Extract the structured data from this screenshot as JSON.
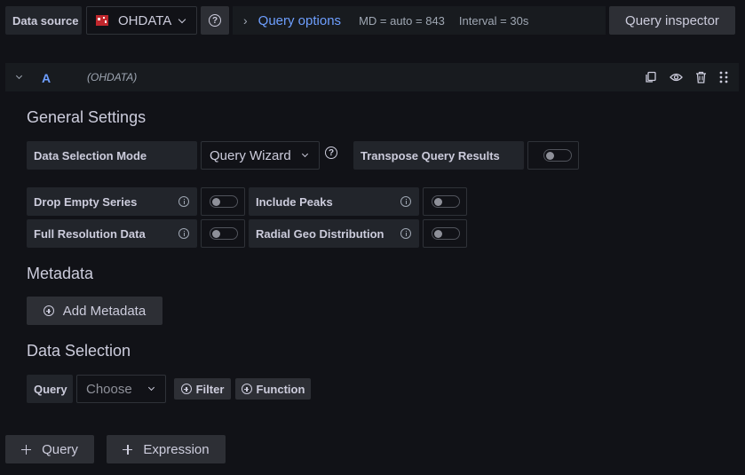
{
  "toolbar": {
    "data_source_label": "Data source",
    "datasource_name": "OHDATA",
    "query_options_label": "Query options",
    "md_info": "MD = auto = 843",
    "interval_info": "Interval = 30s",
    "query_inspector_label": "Query inspector"
  },
  "query_row": {
    "ref_id": "A",
    "datasource_tag": "(OHDATA)"
  },
  "general_settings": {
    "heading": "General Settings",
    "data_selection_mode_label": "Data Selection Mode",
    "data_selection_mode_value": "Query Wizard",
    "transpose_label": "Transpose Query Results",
    "drop_empty_label": "Drop Empty Series",
    "include_peaks_label": "Include Peaks",
    "full_resolution_label": "Full Resolution Data",
    "radial_geo_label": "Radial Geo Distribution"
  },
  "metadata": {
    "heading": "Metadata",
    "add_label": "Add Metadata"
  },
  "data_selection": {
    "heading": "Data Selection",
    "query_label": "Query",
    "query_placeholder": "Choose",
    "filter_label": "Filter",
    "function_label": "Function"
  },
  "footer": {
    "add_query_label": "Query",
    "add_expression_label": "Expression"
  },
  "colors": {
    "background": "#111217",
    "label_bg": "#22252b",
    "accent_blue": "#6e9fff",
    "button_bg": "#2d2f35"
  }
}
